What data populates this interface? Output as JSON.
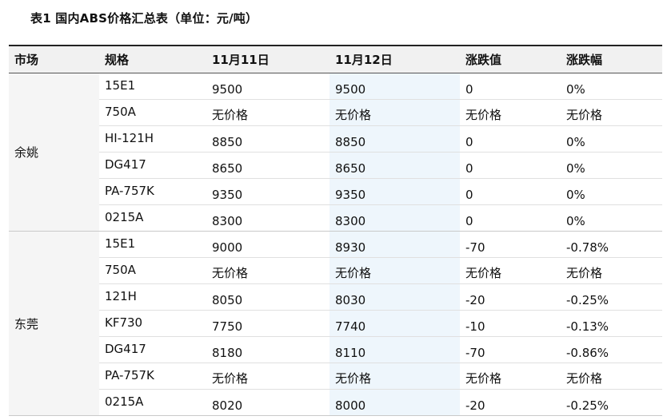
{
  "title": "表1 国内ABS价格汇总表（单位：元/吨）",
  "table": {
    "headers": [
      "市场",
      "规格",
      "11月11日",
      "11月12日",
      "涨跌值",
      "涨跌幅"
    ],
    "groups": [
      {
        "market": "余姚",
        "rows": [
          [
            "15E1",
            "9500",
            "9500",
            "0",
            "0%"
          ],
          [
            "750A",
            "无价格",
            "无价格",
            "无价格",
            "无价格"
          ],
          [
            "HI-121H",
            "8850",
            "8850",
            "0",
            "0%"
          ],
          [
            "DG417",
            "8650",
            "8650",
            "0",
            "0%"
          ],
          [
            "PA-757K",
            "9350",
            "9350",
            "0",
            "0%"
          ],
          [
            "0215A",
            "8300",
            "8300",
            "0",
            "0%"
          ]
        ]
      },
      {
        "market": "东莞",
        "rows": [
          [
            "15E1",
            "9000",
            "8930",
            "-70",
            "-0.78%"
          ],
          [
            "750A",
            "无价格",
            "无价格",
            "无价格",
            "无价格"
          ],
          [
            "121H",
            "8050",
            "8030",
            "-20",
            "-0.25%"
          ],
          [
            "KF730",
            "7750",
            "7740",
            "-10",
            "-0.13%"
          ],
          [
            "DG417",
            "8180",
            "8110",
            "-70",
            "-0.86%"
          ],
          [
            "PA-757K",
            "无价格",
            "无价格",
            "无价格",
            "无价格"
          ],
          [
            "0215A",
            "8020",
            "8000",
            "-20",
            "-0.25%"
          ]
        ]
      }
    ]
  },
  "colors": {
    "header_bg": "#f1f1f1",
    "market_bg": "#f5f5f5",
    "highlight_col": "#eef6fc"
  }
}
